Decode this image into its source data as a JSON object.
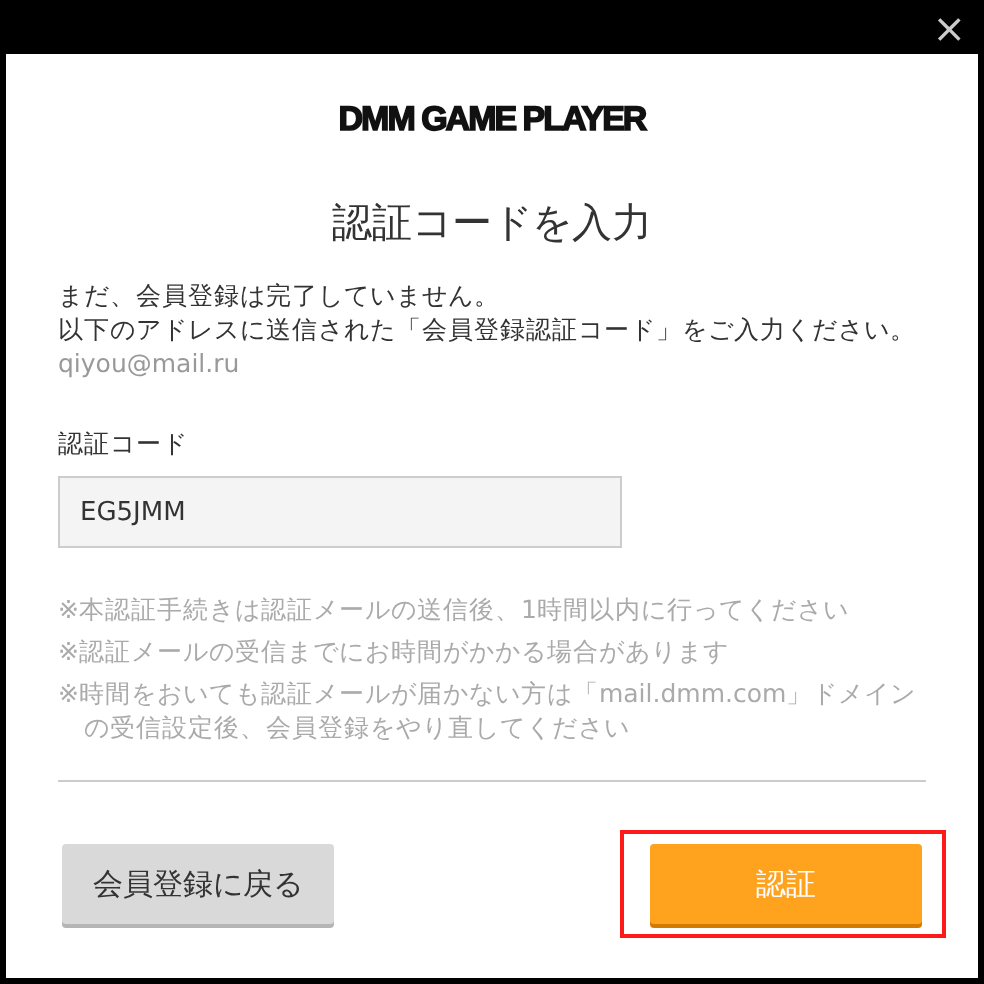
{
  "window": {
    "close": "×"
  },
  "logo": "DMM GAME PLAYER",
  "title": "認証コードを入力",
  "message": [
    "まだ、会員登録は完了していません。",
    "以下のアドレスに送信された「会員登録認証コード」をご入力ください。"
  ],
  "email": "qiyou@mail.ru",
  "code_field": {
    "label": "認証コード",
    "value": "EG5JMM"
  },
  "notes": [
    "※本認証手続きは認証メールの送信後、1時間以内に行ってください",
    "※認証メールの受信までにお時間がかかる場合があります",
    "※時間をおいても認証メールが届かない方は「mail.dmm.com」ドメインの受信設定後、会員登録をやり直してください"
  ],
  "buttons": [
    {
      "label": "会員登録に戻る",
      "kind": "secondary",
      "highlighted": false
    },
    {
      "label": "認証",
      "kind": "primary",
      "highlighted": true
    }
  ]
}
